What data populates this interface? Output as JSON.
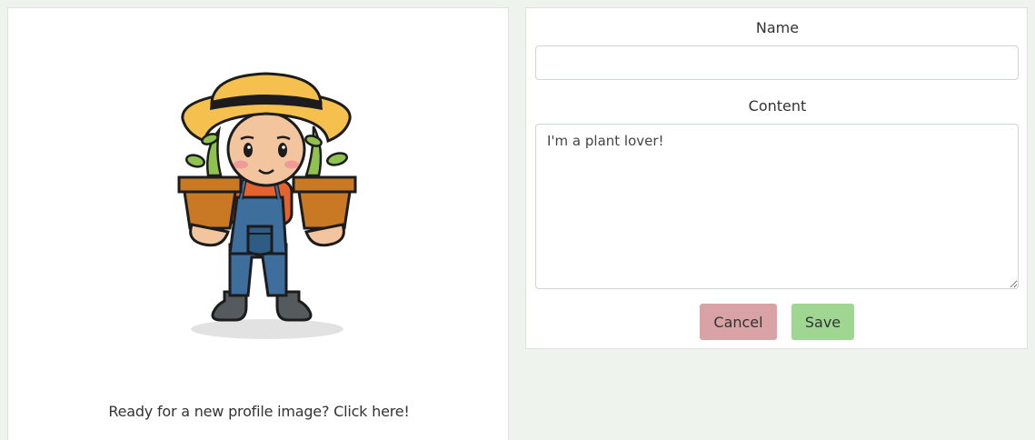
{
  "profile": {
    "avatar_alt": "farmer holding plant pots",
    "change_image_text": "Ready for a new profile image? Click here!"
  },
  "form": {
    "name_label": "Name",
    "name_value": "",
    "content_label": "Content",
    "content_value": "I'm a plant lover!",
    "cancel_label": "Cancel",
    "save_label": "Save"
  },
  "colors": {
    "page_bg": "#eff3ee",
    "cancel_bg": "#d9a3a6",
    "save_bg": "#9fd692"
  }
}
